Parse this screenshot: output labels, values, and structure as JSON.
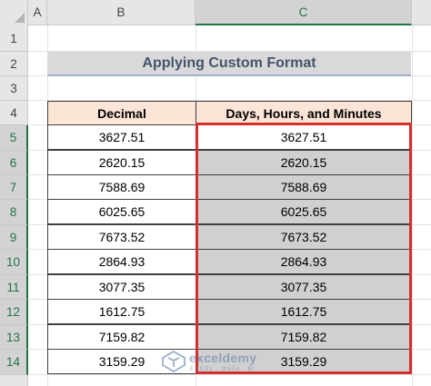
{
  "sheet": {
    "columns": [
      "A",
      "B",
      "C"
    ],
    "rows": [
      "1",
      "2",
      "3",
      "4",
      "5",
      "6",
      "7",
      "8",
      "9",
      "10",
      "11",
      "12",
      "13",
      "14"
    ],
    "title": "Applying Custom Format",
    "table": {
      "headers": [
        "Decimal",
        "Days, Hours, and Minutes"
      ],
      "rows": [
        [
          "3627.51",
          "3627.51"
        ],
        [
          "2620.15",
          "2620.15"
        ],
        [
          "7588.69",
          "7588.69"
        ],
        [
          "6025.65",
          "6025.65"
        ],
        [
          "7673.52",
          "7673.52"
        ],
        [
          "2864.93",
          "2864.93"
        ],
        [
          "3077.35",
          "3077.35"
        ],
        [
          "1612.75",
          "1612.75"
        ],
        [
          "7159.82",
          "7159.82"
        ],
        [
          "3159.29",
          "3159.29"
        ]
      ]
    }
  },
  "watermark": {
    "name": "exceldemy",
    "tagline": "EXCEL · DATA · BI"
  },
  "colors": {
    "header_fill": "#fce4d6",
    "selection_fill": "#d0d0d0",
    "highlight_border": "#d32f2f",
    "excel_green": "#217346"
  }
}
